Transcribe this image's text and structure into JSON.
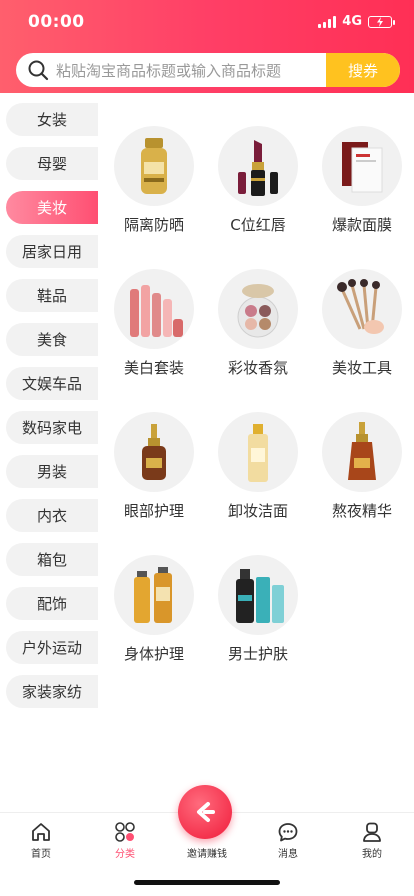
{
  "status_bar": {
    "time": "00:00",
    "network": "4G"
  },
  "search": {
    "placeholder": "粘贴淘宝商品标题或输入商品标题",
    "button_label": "搜券"
  },
  "sidebar": {
    "items": [
      {
        "label": "女装"
      },
      {
        "label": "母婴"
      },
      {
        "label": "美妆",
        "active": true
      },
      {
        "label": "居家日用"
      },
      {
        "label": "鞋品"
      },
      {
        "label": "美食"
      },
      {
        "label": "文娱车品"
      },
      {
        "label": "数码家电"
      },
      {
        "label": "男装"
      },
      {
        "label": "内衣"
      },
      {
        "label": "箱包"
      },
      {
        "label": "配饰"
      },
      {
        "label": "户外运动"
      },
      {
        "label": "家装家纺"
      }
    ]
  },
  "categories": [
    {
      "label": "隔离防晒",
      "icon": "sunscreen-bottle-icon"
    },
    {
      "label": "C位红唇",
      "icon": "lipstick-icon"
    },
    {
      "label": "爆款面膜",
      "icon": "face-mask-icon"
    },
    {
      "label": "美白套装",
      "icon": "skincare-set-icon"
    },
    {
      "label": "彩妆香氛",
      "icon": "eyeshadow-palette-icon"
    },
    {
      "label": "美妆工具",
      "icon": "makeup-brushes-icon"
    },
    {
      "label": "眼部护理",
      "icon": "eye-serum-icon"
    },
    {
      "label": "卸妆洁面",
      "icon": "cleanser-bottle-icon"
    },
    {
      "label": "熬夜精华",
      "icon": "night-serum-icon"
    },
    {
      "label": "身体护理",
      "icon": "body-oil-icon"
    },
    {
      "label": "男士护肤",
      "icon": "men-skincare-icon"
    }
  ],
  "bottom_nav": {
    "items": [
      {
        "label": "首页",
        "icon": "home-icon"
      },
      {
        "label": "分类",
        "icon": "category-icon",
        "active": true
      },
      {
        "label": "邀请赚钱",
        "icon": "invite-icon"
      },
      {
        "label": "消息",
        "icon": "message-icon"
      },
      {
        "label": "我的",
        "icon": "profile-icon"
      }
    ]
  },
  "colors": {
    "brand": "#ff3f66",
    "accent": "#ffc21f",
    "active_text": "#ff4f72"
  }
}
